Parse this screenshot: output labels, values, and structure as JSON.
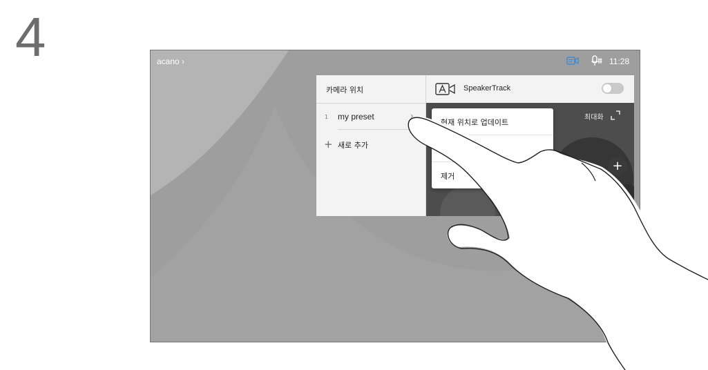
{
  "step": {
    "number": "4"
  },
  "status_bar": {
    "site_name": "acano",
    "site_chevron": "›",
    "clock": "11:28",
    "icons": {
      "camera": "camera-active-icon",
      "mic": "microphone-icon"
    },
    "accent_color": "#3a8bd6"
  },
  "camera_panel": {
    "presets_title": "카메라 위치",
    "presets": [
      {
        "index": "1",
        "name": "my preset",
        "chevron": "›"
      }
    ],
    "add_icon": "+",
    "add_label": "새로 추가",
    "speakertrack": {
      "label": "SpeakerTrack",
      "icon": "speakertrack-icon",
      "enabled": false
    },
    "maximize_label": "최대화",
    "zoom_in_label": "+"
  },
  "context_menu": {
    "items": [
      {
        "label": "현재 위치로 업데이트"
      },
      {
        "label": "이름 변경"
      },
      {
        "label": "제거"
      }
    ]
  }
}
